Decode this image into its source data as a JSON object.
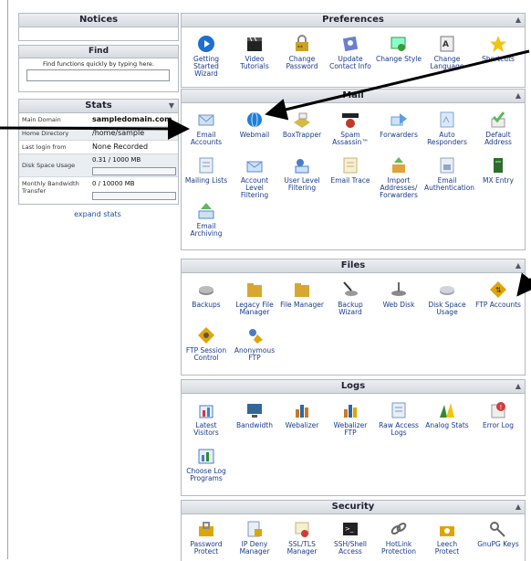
{
  "left": {
    "notices_title": "Notices",
    "find_title": "Find",
    "find_desc": "Find functions quickly by typing here.",
    "stats_title": "Stats",
    "stats": [
      {
        "label": "Main Domain",
        "value": "sampledomain.com"
      },
      {
        "label": "Home Directory",
        "value": "/home/sample"
      },
      {
        "label": "Last login from",
        "value": "None Recorded"
      },
      {
        "label": "Disk Space Usage",
        "value": "0.31 / 1000 MB"
      },
      {
        "label": "Monthly Bandwidth Transfer",
        "value": "0 / 10000 MB"
      }
    ],
    "expand_stats": "expand stats"
  },
  "panels": {
    "preferences": {
      "title": "Preferences",
      "items": [
        "Getting Started Wizard",
        "Video Tutorials",
        "Change Password",
        "Update Contact Info",
        "Change Style",
        "Change Language",
        "Shortcuts"
      ]
    },
    "mail": {
      "title": "Mail",
      "items": [
        "Email Accounts",
        "Webmail",
        "BoxTrapper",
        "Spam Assassin™",
        "Forwarders",
        "Auto Responders",
        "Default Address",
        "Mailing Lists",
        "Account Level Filtering",
        "User Level Filtering",
        "Email Trace",
        "Import Addresses/ Forwarders",
        "Email Authentication",
        "MX Entry",
        "Email Archiving"
      ]
    },
    "files": {
      "title": "Files",
      "items": [
        "Backups",
        "Legacy File Manager",
        "File Manager",
        "Backup Wizard",
        "Web Disk",
        "Disk Space Usage",
        "FTP Accounts",
        "FTP Session Control",
        "Anonymous FTP"
      ]
    },
    "logs": {
      "title": "Logs",
      "items": [
        "Latest Visitors",
        "Bandwidth",
        "Webalizer",
        "Webalizer FTP",
        "Raw Access Logs",
        "Analog Stats",
        "Error Log",
        "Choose Log Programs"
      ]
    },
    "security": {
      "title": "Security",
      "items": [
        "Password Protect",
        "IP Deny Manager",
        "SSL/TLS Manager",
        "SSH/Shell Access",
        "HotLink Protection",
        "Leech Protect",
        "GnuPG Keys"
      ]
    }
  },
  "icons": {
    "getting-started": "#1e6fd0",
    "video": "#222222",
    "password": "#c9a227",
    "contact": "#6a7fd0",
    "style": "#3a9a3a",
    "language": "#777777",
    "shortcuts": "#f2c40f",
    "email": "#6f95c8",
    "webmail": "#1f7fd8",
    "boxtrapper": "#d4b84a",
    "spam": "#c0392b",
    "forwarders": "#5aa0e0",
    "responders": "#7ea6d6",
    "default": "#5fb85f",
    "mailing": "#7b9bc4",
    "account-filter": "#5b8fd0",
    "user-filter": "#4a7ec4",
    "trace": "#c8b46a",
    "import": "#e2a23a",
    "auth": "#8fa7c2",
    "mx": "#2e6b2e",
    "archive": "#4f8bcb",
    "backups": "#8a8a8a",
    "folder": "#d9a72f",
    "web-disk": "#888888",
    "disk-usage": "#9aa3ad",
    "ftp": "#e0a400",
    "bandwidth": "#336699",
    "webalizer": "#c8782a",
    "raw-logs": "#7c98c3",
    "analog": "#2f8a2f",
    "error-log": "#d03c3c",
    "choose-log": "#4a7ec4",
    "lock": "#e0a400",
    "gnupg": "#666666"
  }
}
